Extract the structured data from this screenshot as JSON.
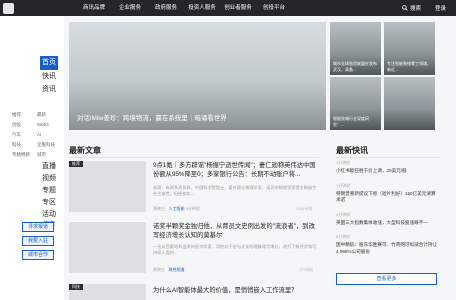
{
  "nav": [
    "商讯品牌",
    "企业服务",
    "政府服务",
    "投资人服务",
    "创业者服务",
    "创投平台"
  ],
  "top_right": {
    "search": "搜索",
    "login": "登录"
  },
  "sidebar": {
    "main_top": [
      "首页",
      "快讯",
      "资讯"
    ],
    "active": "首页",
    "sub": [
      "推荐",
      "最新",
      "创投",
      "Web3",
      "汽车",
      "AI",
      "科技",
      "企服科技",
      "专精特新",
      "城市"
    ],
    "main_mid": [
      "直播",
      "视频",
      "专题",
      "专区",
      "活动"
    ],
    "search": "搜索",
    "buttons": [
      "寻求报道",
      "我要入驻",
      "城市合作"
    ]
  },
  "hero": {
    "caption": "对话iMile姜珍：跨境物流，赢在系统里｜暗涌看世界"
  },
  "thumbs": [
    "城市全球智造联盟在发布武汉，具备...",
    "专注智能装修零工领域，新近...",
    "智能终端行业深度研究：...",
    ""
  ],
  "latest": {
    "title": "最新文章"
  },
  "articles": [
    {
      "tag": "推荐",
      "title": "9点1氪｜多方辟谣\"杨振宁逝世传闻\"；妻仁勋称英伟达中国份额从95%降至0；多家银行公告：长期不动账户将...",
      "body": "宏观：有两条消息称，中国科学院院士、著名理论物理学家，诺贝尔物理学奖得主杨振宁先生逝世，但经核实...",
      "author": "黄晓庄  ·  ",
      "column": "人工智能",
      "time": "9分钟前",
      "time_right": "26分钟前"
    },
    {
      "tag": "",
      "title": "诺奖半颗奖金独归他，从育员文史例出发的\"流浪者\"，到改写经济增长认知的莫基尔",
      "body": "一位从西奥地利出发的经济学家，用他对于史与文化的理解改写增长，改写了新经济和可持续人类的...",
      "author": "黄晓庄  ·  ",
      "column": "财经频道",
      "time": "",
      "time_right": "1分钟前"
    },
    {
      "tag": "科技",
      "title": "为什么AI智能体最大的价值，是悄悄嵌入工作流里？",
      "body": "",
      "author": "",
      "column": "",
      "time": "",
      "time_right": ""
    }
  ],
  "news": {
    "title": "最新快讯",
    "items": [
      {
        "time": "1分钟前",
        "text": "小红书能狂胜于价上调，25美元/股"
      },
      {
        "time": "1分钟前",
        "text": "特朗普重新提议下修（短片利好）150亿美元清算承诺"
      },
      {
        "time": "4分钟前",
        "text": "英国三大指数集体收涨，大型科技股涨跌不一"
      },
      {
        "time": "5分钟前",
        "text": "国中精航：股东华胜赛可、竹荷网可拟减合计持让4.998%公司股份"
      }
    ],
    "more": "查看更多"
  }
}
